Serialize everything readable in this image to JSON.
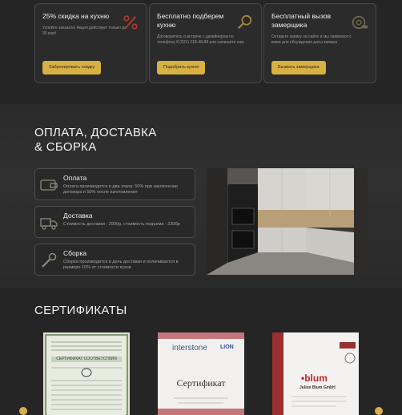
{
  "offers": [
    {
      "title": "25% скидка на кухню",
      "text": "Успейте заказать! Акция действует только до 30 мая!",
      "button": "Забронировать скидку",
      "icon": "percent-icon"
    },
    {
      "title": "Бесплатно подберем кухню",
      "text": "Договоритесь о встрече с дизайнером по телефону 8 (931) 218-48-88 или напишите нам",
      "button": "Подобрать кухню",
      "icon": "search-icon"
    },
    {
      "title": "Бесплатный вызов замерщика",
      "text": "Оставьте заявку на сайте и мы свяжемся с вами для обсуждения даты замера",
      "button": "Вызвать замерщика",
      "icon": "tape-measure-icon"
    }
  ],
  "payment": {
    "title_line1": "ОПЛАТА, ДОСТАВКА",
    "title_line2": "& СБОРКА",
    "items": [
      {
        "title": "Оплата",
        "text": "Оплата производится в два этапа: 50% при заключении договора и 50% после изготовления",
        "icon": "wallet-icon"
      },
      {
        "title": "Доставка",
        "text": "Стоимость доставки - 2500р, стоимость подъема - 2300р",
        "icon": "truck-icon"
      },
      {
        "title": "Сборка",
        "text": "Сборка производится в день доставки и оплачивается в размере 10% от стоимости кухни",
        "icon": "wrench-icon"
      }
    ]
  },
  "certificates": {
    "title": "СЕРТИФИКАТЫ",
    "cert1_heading": "СЕРТИФИКАТ СООТВЕТСТВИЯ",
    "cert2_brand": "interstone",
    "cert2_brand2": "LION",
    "cert2_heading": "Сертификат",
    "cert3_brand": "blum",
    "cert3_company": "Julius Blum GmbH"
  },
  "colors": {
    "accent": "#d8b043",
    "background": "#252525"
  }
}
